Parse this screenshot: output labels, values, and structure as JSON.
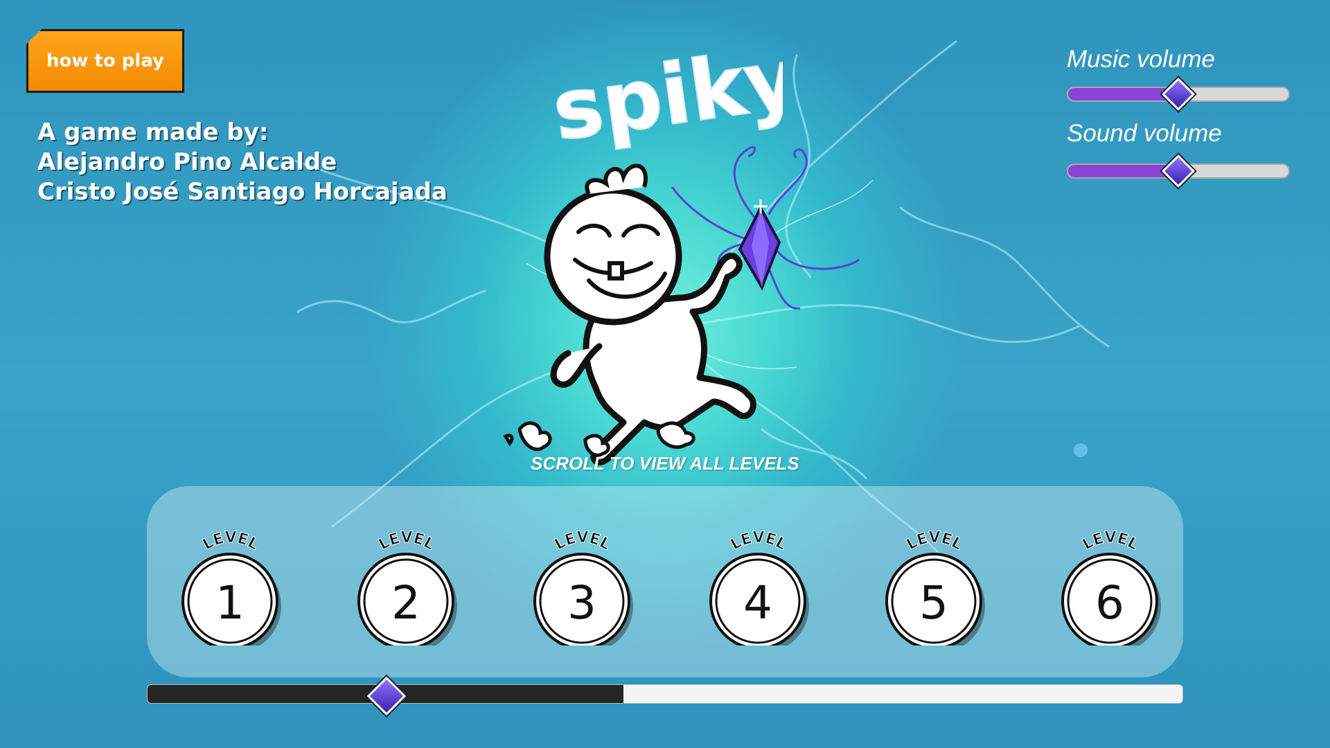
{
  "game_title": "spiky",
  "how_to_play_label": "how to play",
  "credits": {
    "heading": "A game made by:",
    "authors": [
      "Alejandro Pino Alcalde",
      "Cristo José Santiago Horcajada"
    ]
  },
  "settings": {
    "music": {
      "label": "Music volume",
      "value": 0.5
    },
    "sound": {
      "label": "Sound volume",
      "value": 0.5
    }
  },
  "scroll_hint": "SCROLL TO VIEW ALL LEVELS",
  "level_badge_text": "LEVEL",
  "levels": [
    "1",
    "2",
    "3",
    "4",
    "5",
    "6"
  ],
  "level_scroll_position": 0.46,
  "colors": {
    "background": "#2f96bf",
    "glow": "#6ff0dc",
    "accent_purple": "#8a44d8",
    "button_orange": "#f89a0c"
  },
  "icons": [
    "crystal-gem-icon",
    "diamond-slider-handle-icon"
  ]
}
